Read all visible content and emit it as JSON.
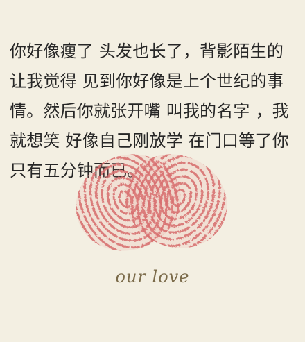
{
  "poem": {
    "lines": [
      "你好像瘦了 头发也长了，背影陌生的",
      "让我觉得 见到你好像是上个世纪的事",
      "情。然后你就张开嘴 叫我的名字 ，我",
      "就想笑 好像自己刚放学 在门口等了你",
      "只有五分钟而已。"
    ]
  },
  "caption": "our love",
  "colors": {
    "background": "#f3efe2",
    "text": "#262626",
    "heart": "#d86f70",
    "caption": "#7b6b4a"
  }
}
